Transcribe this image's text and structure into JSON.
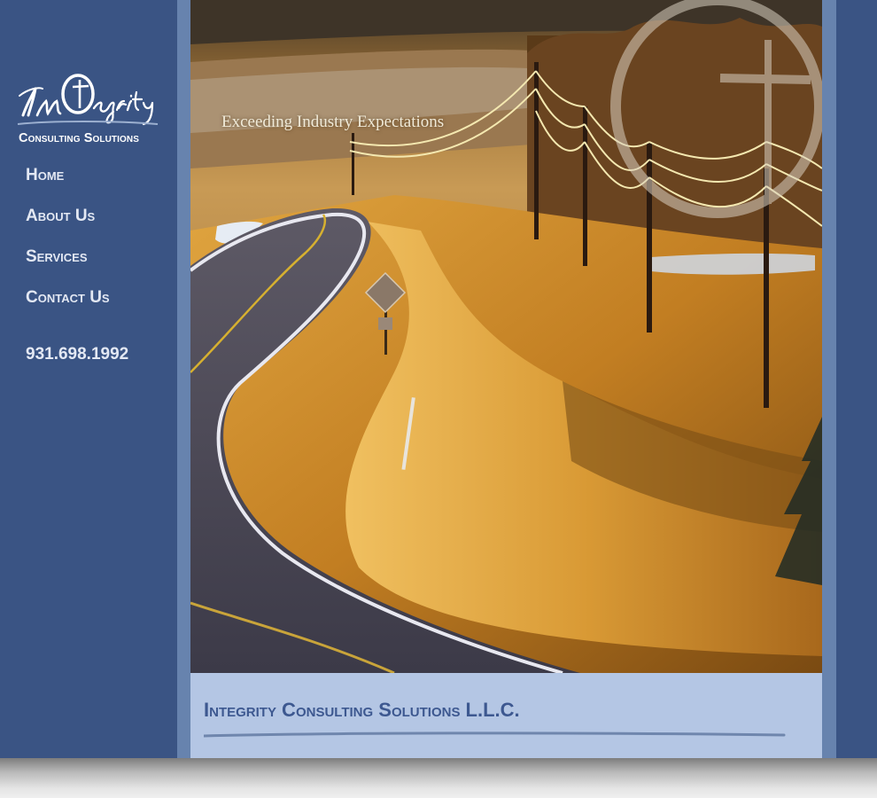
{
  "brand": {
    "logo_script": "InTegrity",
    "logo_subtitle": "Consulting Solutions"
  },
  "nav": {
    "items": [
      {
        "label": "Home"
      },
      {
        "label": "About Us"
      },
      {
        "label": "Services"
      },
      {
        "label": "Contact Us"
      }
    ]
  },
  "contact": {
    "phone": "931.698.1992"
  },
  "hero": {
    "tagline": "Exceeding Industry Expectations",
    "image_description_icon": "cross-circle-icon"
  },
  "main": {
    "title": "Integrity Consulting Solutions L.L.C.",
    "intro_text": ""
  },
  "colors": {
    "frame": "#3a5484",
    "stripe": "#6783ae",
    "content_bg": "#b4c6e4",
    "title": "#3d5890",
    "nav_text": "#e3e8f3"
  }
}
